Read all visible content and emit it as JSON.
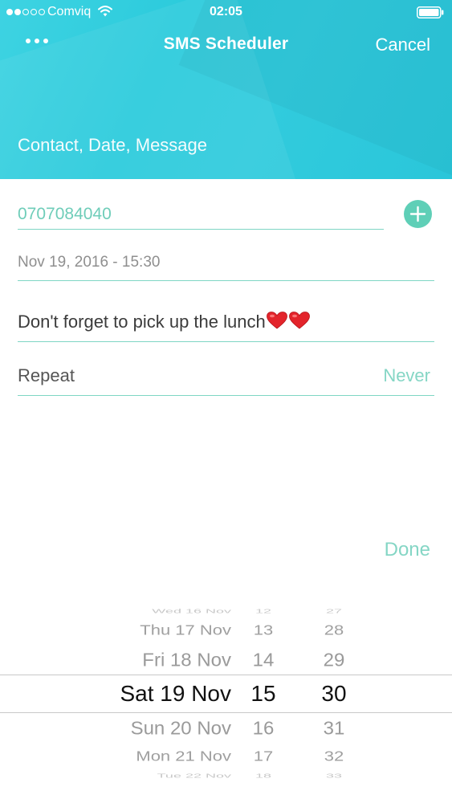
{
  "status_bar": {
    "carrier": "Comviq",
    "time": "02:05",
    "signal_filled": 2,
    "signal_total": 5
  },
  "nav": {
    "more_icon": "more-dots-icon",
    "title": "SMS Scheduler",
    "cancel_label": "Cancel"
  },
  "header": {
    "subtitle": "Contact, Date, Message",
    "color": "#2ccbdc"
  },
  "form": {
    "contact_value": "0707084040",
    "add_icon": "plus-circle-icon",
    "date_value": "Nov 19, 2016 - 15:30",
    "message_text": "Don't forget to pick up the lunch",
    "message_emojis": [
      "heart-icon",
      "heart-icon"
    ],
    "repeat_label": "Repeat",
    "repeat_value": "Never",
    "accent_color": "#5fcfb7"
  },
  "done_label": "Done",
  "picker": {
    "days": [
      "Wed 16 Nov",
      "Thu 17 Nov",
      "Fri 18 Nov",
      "Sat 19 Nov",
      "Sun 20 Nov",
      "Mon 21 Nov",
      "Tue 22 Nov"
    ],
    "hours": [
      "12",
      "13",
      "14",
      "15",
      "16",
      "17",
      "18"
    ],
    "minutes": [
      "27",
      "28",
      "29",
      "30",
      "31",
      "32",
      "33"
    ],
    "selected_index": 3
  }
}
